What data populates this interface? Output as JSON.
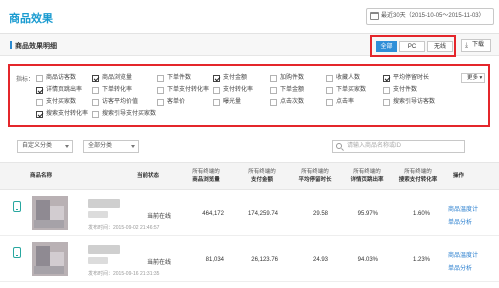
{
  "header": {
    "title": "商品效果",
    "date_range": "最近30天（2015-10-05～2015-11-03）",
    "calendar_icon": "calendar-icon"
  },
  "section": {
    "title": "商品效果明细",
    "terminal_tabs": [
      {
        "label": "全部",
        "active": true
      },
      {
        "label": "PC",
        "active": false
      },
      {
        "label": "无线",
        "active": false
      }
    ],
    "download_label": "下载",
    "download_icon": "download-arrow-icon"
  },
  "metrics": {
    "label": "指标：",
    "more_label": "更多",
    "rows": [
      [
        {
          "label": "商品访客数",
          "checked": false
        },
        {
          "label": "商品浏览量",
          "checked": true
        },
        {
          "label": "下单件数",
          "checked": false
        },
        {
          "label": "支付金额",
          "checked": true
        },
        {
          "label": "加购件数",
          "checked": false
        },
        {
          "label": "收藏人数",
          "checked": false
        },
        {
          "label": "平均停留时长",
          "checked": true
        }
      ],
      [
        {
          "label": "详情页跳出率",
          "checked": true
        },
        {
          "label": "下单转化率",
          "checked": false
        },
        {
          "label": "下单支付转化率",
          "checked": false
        },
        {
          "label": "支付转化率",
          "checked": false
        },
        {
          "label": "下单金额",
          "checked": false
        },
        {
          "label": "下单买家数",
          "checked": false
        },
        {
          "label": "支付件数",
          "checked": false
        }
      ],
      [
        {
          "label": "支付买家数",
          "checked": false
        },
        {
          "label": "访客平均价值",
          "checked": false
        },
        {
          "label": "客单价",
          "checked": false
        },
        {
          "label": "曝光量",
          "checked": false
        },
        {
          "label": "点击次数",
          "checked": false
        },
        {
          "label": "点击率",
          "checked": false
        },
        {
          "label": "搜索引导访客数",
          "checked": false
        }
      ],
      [
        {
          "label": "搜索支付转化率",
          "checked": true
        },
        {
          "label": "搜索引导支付买家数",
          "checked": false
        }
      ]
    ]
  },
  "filters": {
    "category1": "自定义分类",
    "category2": "全部分类",
    "search_placeholder": "请输入商品名称或ID"
  },
  "table": {
    "columns": [
      {
        "label": "商品名称",
        "sub": ""
      },
      {
        "label": "当前状态",
        "sub": ""
      },
      {
        "label": "商品浏览量",
        "sub": "所有终端的"
      },
      {
        "label": "支付金额",
        "sub": "所有终端的"
      },
      {
        "label": "平均停留时长",
        "sub": "所有终端的"
      },
      {
        "label": "详情页跳出率",
        "sub": "所有终端的"
      },
      {
        "label": "搜索支付转化率",
        "sub": "所有终端的"
      },
      {
        "label": "操作",
        "sub": ""
      }
    ],
    "rows": [
      {
        "publish_time": "发布时间：2015-09-02 21:46:57",
        "status": "当前在线",
        "views": "464,172",
        "pay_amount": "174,259.74",
        "avg_stay": "29.58",
        "bounce_rate": "95.97%",
        "search_conv": "1.60%",
        "action_temperature": "商品温度计",
        "action_analysis": "单品分析"
      },
      {
        "publish_time": "发布时间：2015-09-16 21:31:35",
        "status": "当前在线",
        "views": "81,034",
        "pay_amount": "26,123.76",
        "avg_stay": "24.93",
        "bounce_rate": "94.03%",
        "search_conv": "1.23%",
        "action_temperature": "商品温度计",
        "action_analysis": "单品分析"
      }
    ]
  }
}
